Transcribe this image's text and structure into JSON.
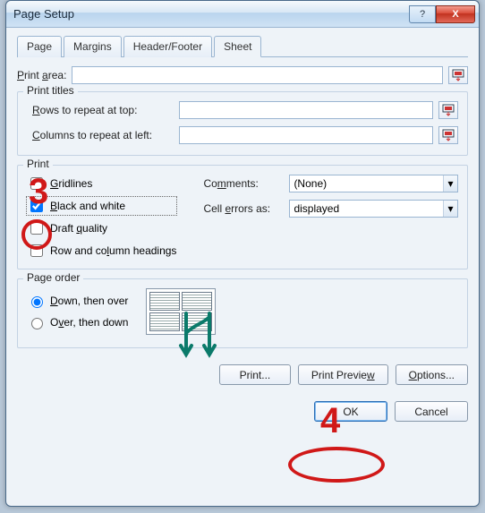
{
  "window": {
    "title": "Page Setup",
    "help_label": "?",
    "close_label": "X"
  },
  "tabs": {
    "page": "Page",
    "margins": "Margins",
    "header_footer": "Header/Footer",
    "sheet": "Sheet"
  },
  "fields": {
    "print_area_label": "Print area:",
    "print_area_value": "",
    "print_titles_label": "Print titles",
    "rows_repeat_label": "Rows to repeat at top:",
    "rows_repeat_value": "",
    "cols_repeat_label": "Columns to repeat at left:",
    "cols_repeat_value": ""
  },
  "print": {
    "group_label": "Print",
    "gridlines": "Gridlines",
    "bw": "Black and white",
    "draft": "Draft quality",
    "rowcol": "Row and column headings",
    "comments_label": "Comments:",
    "comments_value": "(None)",
    "errors_label": "Cell errors as:",
    "errors_value": "displayed",
    "checked": {
      "gridlines": false,
      "bw": true,
      "draft": false,
      "rowcol": false
    }
  },
  "page_order": {
    "group_label": "Page order",
    "down_over": "Down, then over",
    "over_down": "Over, then down",
    "selected": "down_over"
  },
  "buttons": {
    "print": "Print...",
    "preview": "Print Preview",
    "options": "Options...",
    "ok": "OK",
    "cancel": "Cancel"
  },
  "annotations": {
    "num3": "3",
    "num4": "4"
  }
}
